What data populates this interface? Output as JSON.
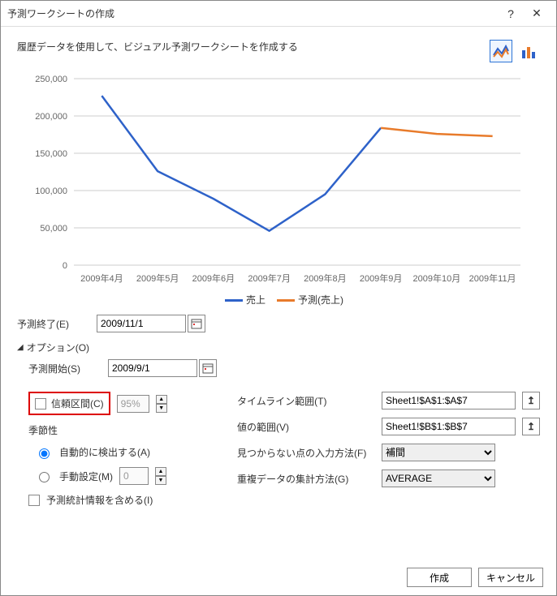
{
  "window": {
    "title": "予測ワークシートの作成",
    "help_label": "?",
    "close_label": "✕"
  },
  "header": {
    "subtitle": "履歴データを使用して、ビジュアル予測ワークシートを作成する"
  },
  "chart_data": {
    "type": "line",
    "categories": [
      "2009年4月",
      "2009年5月",
      "2009年6月",
      "2009年7月",
      "2009年8月",
      "2009年9月",
      "2009年10月",
      "2009年11月"
    ],
    "series": [
      {
        "name": "売上",
        "color": "#2e62c9",
        "values": [
          227000,
          126000,
          89000,
          46000,
          95000,
          184000,
          null,
          null
        ]
      },
      {
        "name": "予測(売上)",
        "color": "#e87b2b",
        "values": [
          null,
          null,
          null,
          null,
          null,
          184000,
          176000,
          173000
        ]
      }
    ],
    "ylabel": "",
    "xlabel": "",
    "ylim": [
      0,
      250000
    ],
    "yticks": [
      0,
      50000,
      100000,
      150000,
      200000,
      250000
    ],
    "ytick_labels": [
      "0",
      "50,000",
      "100,000",
      "150,000",
      "200,000",
      "250,000"
    ]
  },
  "form": {
    "forecast_end_label": "予測終了(E)",
    "forecast_end_value": "2009/11/1",
    "options_label": "オプション(O)",
    "forecast_start_label": "予測開始(S)",
    "forecast_start_value": "2009/9/1",
    "confidence_label": "信頼区間(C)",
    "confidence_value": "95%",
    "seasonality_label": "季節性",
    "seasonality_auto_label": "自動的に検出する(A)",
    "seasonality_manual_label": "手動設定(M)",
    "seasonality_manual_value": "0",
    "include_stats_label": "予測統計情報を含める(I)",
    "timeline_range_label": "タイムライン範囲(T)",
    "timeline_range_value": "Sheet1!$A$1:$A$7",
    "values_range_label": "値の範囲(V)",
    "values_range_value": "Sheet1!$B$1:$B$7",
    "missing_points_label": "見つからない点の入力方法(F)",
    "missing_points_value": "補間",
    "aggregate_label": "重複データの集計方法(G)",
    "aggregate_value": "AVERAGE"
  },
  "footer": {
    "create_label": "作成",
    "cancel_label": "キャンセル"
  },
  "icons": {
    "arrow_up": "↥"
  }
}
